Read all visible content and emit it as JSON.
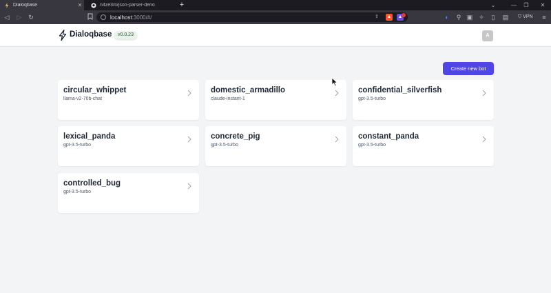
{
  "browser": {
    "tabs": [
      {
        "title": "Dialoqbase",
        "active": true
      },
      {
        "title": "n4ze3m/json-parser-deno",
        "active": false
      }
    ],
    "url": {
      "host": "localhost",
      "path": ":3000/#/"
    },
    "vpn_label": "VPN"
  },
  "header": {
    "brand": "Dialoqbase",
    "version": "v0.0.23",
    "avatar_initial": "A"
  },
  "main": {
    "create_button_label": "Create new bot",
    "bots": [
      {
        "name": "circular_whippet",
        "model": "llama-v2-70b-chat"
      },
      {
        "name": "domestic_armadillo",
        "model": "claude-instant-1"
      },
      {
        "name": "confidential_silverfish",
        "model": "gpt-3.5-turbo"
      },
      {
        "name": "lexical_panda",
        "model": "gpt-3.5-turbo"
      },
      {
        "name": "concrete_pig",
        "model": "gpt-3.5-turbo"
      },
      {
        "name": "constant_panda",
        "model": "gpt-3.5-turbo"
      },
      {
        "name": "controlled_bug",
        "model": "gpt-3.5-turbo"
      }
    ]
  },
  "colors": {
    "accent": "#4f46e5",
    "background": "#f3f4f6",
    "card": "#ffffff"
  }
}
